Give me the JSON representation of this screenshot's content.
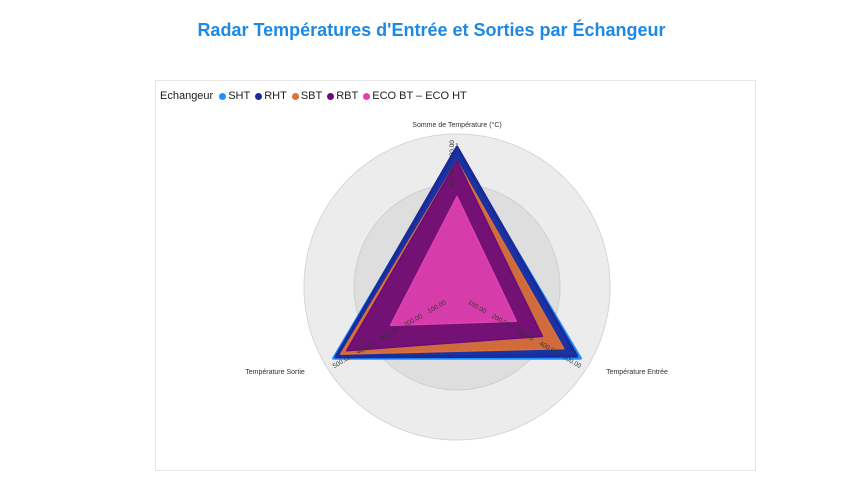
{
  "title": "Radar Températures d'Entrée et Sorties par Échangeur",
  "legend": {
    "title": "Echangeur",
    "items": [
      {
        "label": "SHT",
        "color": "#1e90ff"
      },
      {
        "label": "RHT",
        "color": "#1a2a9a"
      },
      {
        "label": "SBT",
        "color": "#e07035"
      },
      {
        "label": "RBT",
        "color": "#6a0a7a"
      },
      {
        "label": "ECO BT – ECO HT",
        "color": "#e040b0"
      }
    ]
  },
  "chart_data": {
    "type": "radar",
    "axes": [
      "Somme de Température (°C)",
      "Température Entrée",
      "Température Sortie"
    ],
    "tick_values": [
      100,
      200,
      300,
      400,
      500
    ],
    "tick_labels_top": [
      "",
      "",
      "",
      "400.00",
      "500.00"
    ],
    "tick_labels_right": [
      "100.00",
      "200.00",
      "300.00",
      "400.00",
      "500.00"
    ],
    "tick_labels_left": [
      "100.00",
      "200.00",
      "300.00",
      "400.00",
      "500.00"
    ],
    "rmax": 500,
    "series": [
      {
        "name": "SHT",
        "color": "#1e90ff",
        "values": [
          500,
          520,
          520
        ]
      },
      {
        "name": "RHT",
        "color": "#1a2a9a",
        "values": [
          510,
          505,
          510
        ]
      },
      {
        "name": "SBT",
        "color": "#e07035",
        "values": [
          460,
          450,
          490
        ]
      },
      {
        "name": "RBT",
        "color": "#6a0a7a",
        "values": [
          460,
          360,
          465
        ]
      },
      {
        "name": "ECO BT – ECO HT",
        "color": "#e040b0",
        "values": [
          330,
          250,
          280
        ]
      }
    ]
  }
}
